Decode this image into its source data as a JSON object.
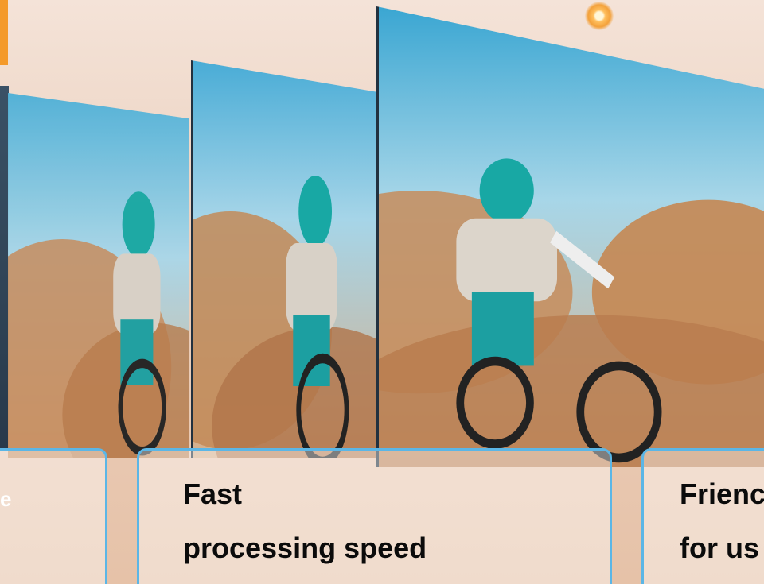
{
  "cards": {
    "mid": {
      "title": "Fast",
      "subtitle": "processing speed"
    },
    "right": {
      "title": "Frienc",
      "subtitle": "for us"
    }
  },
  "left_strip_glyph": "e",
  "colors": {
    "card_border": "#5bb6e6",
    "accent_orange": "#f49a2a",
    "sky": "#7fc0de",
    "dust": "#c98f60"
  },
  "icons": [
    "circuit-node-icon"
  ]
}
